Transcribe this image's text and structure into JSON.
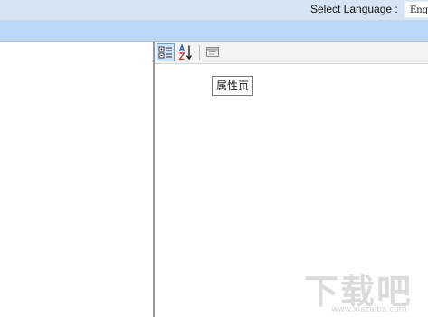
{
  "header": {
    "select_language_label": "Select Language :",
    "language_value": "English"
  },
  "property_grid": {
    "toolbar": {
      "categorized_icon": "categorized-icon",
      "alphabetical_icon": "sort-alphabetical-icon",
      "property_pages_icon": "property-pages-icon"
    },
    "tooltip": "属性页"
  },
  "watermark": {
    "text": "下载吧",
    "url": "www.xiazaiba.com"
  },
  "colors": {
    "top_bar": "#d6e4f3",
    "blue_bar": "#bcd7f5",
    "splitter": "#9a9a9a",
    "toolbar_active": "#cfe3f8"
  }
}
